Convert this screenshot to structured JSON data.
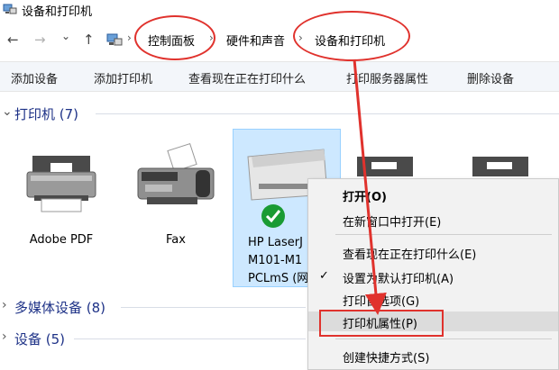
{
  "window": {
    "title": "设备和打印机"
  },
  "nav": {
    "back": "←",
    "forward": "→",
    "dropdown": "⌄",
    "up": "↑"
  },
  "breadcrumb": {
    "items": [
      "控制面板",
      "硬件和声音",
      "设备和打印机"
    ],
    "separator": "›"
  },
  "toolbar": {
    "items": [
      "添加设备",
      "添加打印机",
      "查看现在正在打印什么",
      "打印服务器属性",
      "删除设备"
    ]
  },
  "sections": {
    "printers": {
      "label": "打印机 (7)",
      "chevron": "⌄"
    },
    "multimedia": {
      "label": "多媒体设备 (8)",
      "chevron": "›"
    },
    "devices": {
      "label": "设备 (5)",
      "chevron": "›"
    }
  },
  "devices": [
    {
      "name": "Adobe PDF",
      "icon": "printer-icon"
    },
    {
      "name": "Fax",
      "icon": "fax-icon"
    },
    {
      "name": "HP LaserJ\nM101-M1\nPCLmS (网",
      "icon": "laser-printer-icon",
      "status": "default-check"
    }
  ],
  "context_menu": {
    "items": [
      {
        "label": "打开(O)",
        "bold": true
      },
      {
        "label": "在新窗口中打开(E)"
      },
      {
        "label": "查看现在正在打印什么(E)"
      },
      {
        "label": "设置为默认打印机(A)",
        "checked": true,
        "check_glyph": "✓"
      },
      {
        "label": "打印首选项(G)"
      },
      {
        "label": "打印机属性(P)",
        "highlighted": true
      },
      {
        "label": "创建快捷方式(S)"
      }
    ]
  },
  "colors": {
    "annotation": "#e0322d",
    "section_label": "#1e3287",
    "selection": "#cde8ff"
  }
}
